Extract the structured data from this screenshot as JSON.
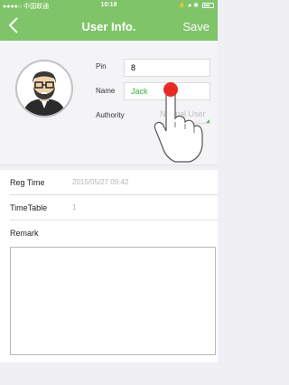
{
  "status_bar": {
    "carrier": "●●●●○ 中国联通",
    "time": "10:19",
    "indicators": "⚡ ● ✱"
  },
  "nav": {
    "title": "User Info.",
    "save_label": "Save",
    "back_icon": "chevron-left-icon"
  },
  "profile": {
    "pin_label": "Pin",
    "pin_value": "8",
    "name_label": "Name",
    "name_value": "Jack",
    "authority_label": "Authority",
    "authority_value": "Normal User"
  },
  "details": {
    "reg_time_label": "Reg Time",
    "reg_time_value": "2015/05/27 09:42",
    "timetable_label": "TimeTable",
    "timetable_value": "1",
    "remark_label": "Remark",
    "remark_value": ""
  },
  "colors": {
    "brand_green": "#7fc469",
    "name_text_green": "#33b533",
    "tap_indicator_red": "#e8201c"
  }
}
